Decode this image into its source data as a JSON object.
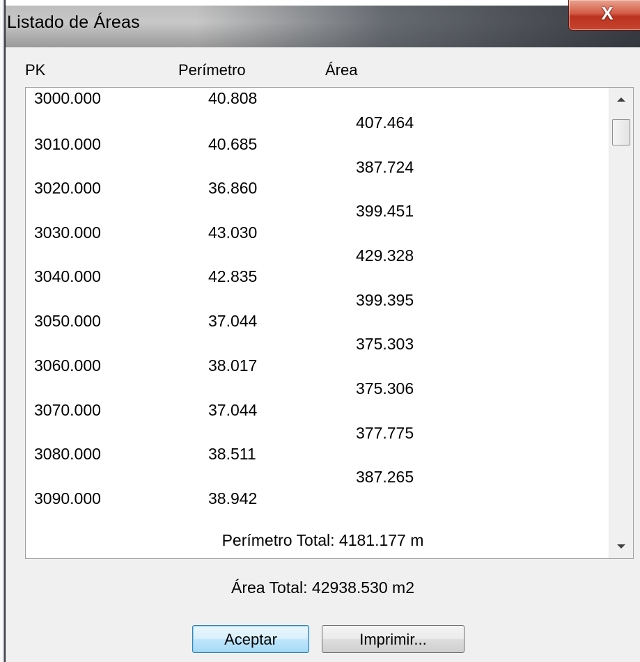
{
  "window": {
    "title": "Listado de Áreas",
    "close_glyph": "X"
  },
  "columns": {
    "pk": "PK",
    "perimetro": "Perímetro",
    "area": "Área"
  },
  "rows": [
    {
      "pk": "3000.000",
      "perimetro": "40.808"
    },
    {
      "pk": "3010.000",
      "perimetro": "40.685"
    },
    {
      "pk": "3020.000",
      "perimetro": "36.860"
    },
    {
      "pk": "3030.000",
      "perimetro": "43.030"
    },
    {
      "pk": "3040.000",
      "perimetro": "42.835"
    },
    {
      "pk": "3050.000",
      "perimetro": "37.044"
    },
    {
      "pk": "3060.000",
      "perimetro": "38.017"
    },
    {
      "pk": "3070.000",
      "perimetro": "37.044"
    },
    {
      "pk": "3080.000",
      "perimetro": "38.511"
    },
    {
      "pk": "3090.000",
      "perimetro": "38.942"
    }
  ],
  "areas": [
    "407.464",
    "387.724",
    "399.451",
    "429.328",
    "399.395",
    "375.303",
    "375.306",
    "377.775",
    "387.265"
  ],
  "summary": {
    "perimetro_total": "Perímetro Total: 4181.177 m",
    "area_total": "Área Total: 42938.530 m2"
  },
  "buttons": {
    "aceptar": "Aceptar",
    "imprimir": "Imprimir..."
  },
  "icons": {
    "close": "close-icon",
    "scroll_up": "scroll-up-arrow-icon",
    "scroll_down": "scroll-down-arrow-icon"
  }
}
